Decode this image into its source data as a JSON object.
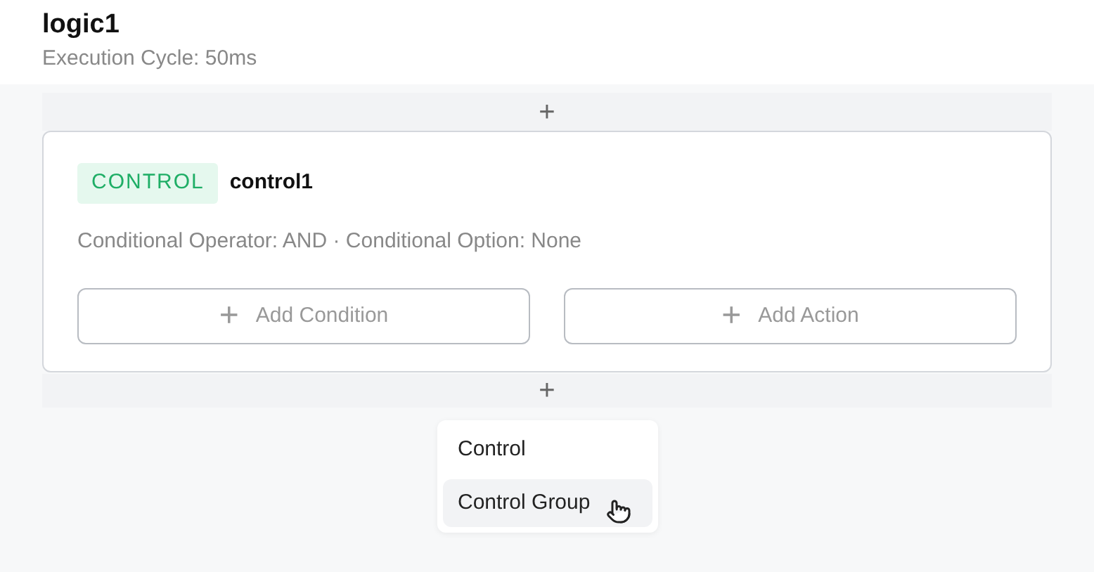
{
  "header": {
    "title": "logic1",
    "subtitle": "Execution Cycle: 50ms"
  },
  "add_above": "+",
  "card": {
    "badge": "CONTROL",
    "name": "control1",
    "description": "Conditional Operator: AND · Conditional Option: None",
    "buttons": [
      {
        "icon": "+",
        "label": "Add Condition"
      },
      {
        "icon": "+",
        "label": "Add Action"
      }
    ]
  },
  "add_below": "+",
  "menu": [
    {
      "label": "Control",
      "selected": false
    },
    {
      "label": "Control Group",
      "selected": true
    }
  ]
}
